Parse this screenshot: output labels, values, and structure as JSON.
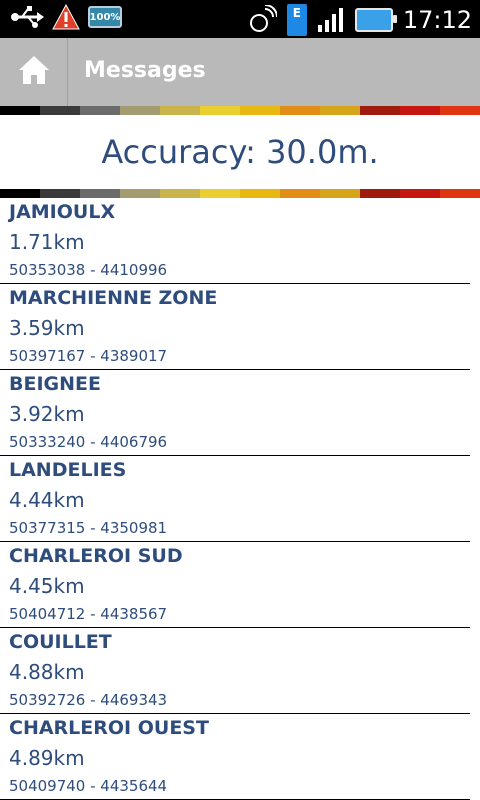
{
  "status_bar": {
    "time": "17:12",
    "battery_small_label": "100%"
  },
  "header": {
    "title": "Messages"
  },
  "accuracy": "Accuracy: 30.0m.",
  "stripe_colors": [
    "#000000",
    "#3a3a3a",
    "#6b6b6b",
    "#a39c70",
    "#c9b54c",
    "#e9cf2f",
    "#e8b812",
    "#e28e16",
    "#d6a51a",
    "#9e1b0e",
    "#c51610",
    "#e03512"
  ],
  "items": [
    {
      "name": "JAMIOULX",
      "distance": "1.71km",
      "coords": "50353038 - 4410996"
    },
    {
      "name": "MARCHIENNE ZONE",
      "distance": "3.59km",
      "coords": "50397167 - 4389017"
    },
    {
      "name": "BEIGNEE",
      "distance": "3.92km",
      "coords": "50333240 - 4406796"
    },
    {
      "name": "LANDELIES",
      "distance": "4.44km",
      "coords": "50377315 - 4350981"
    },
    {
      "name": "CHARLEROI SUD",
      "distance": "4.45km",
      "coords": "50404712 - 4438567"
    },
    {
      "name": "COUILLET",
      "distance": "4.88km",
      "coords": "50392726 - 4469343"
    },
    {
      "name": "CHARLEROI OUEST",
      "distance": "4.89km",
      "coords": "50409740 - 4435644"
    }
  ]
}
